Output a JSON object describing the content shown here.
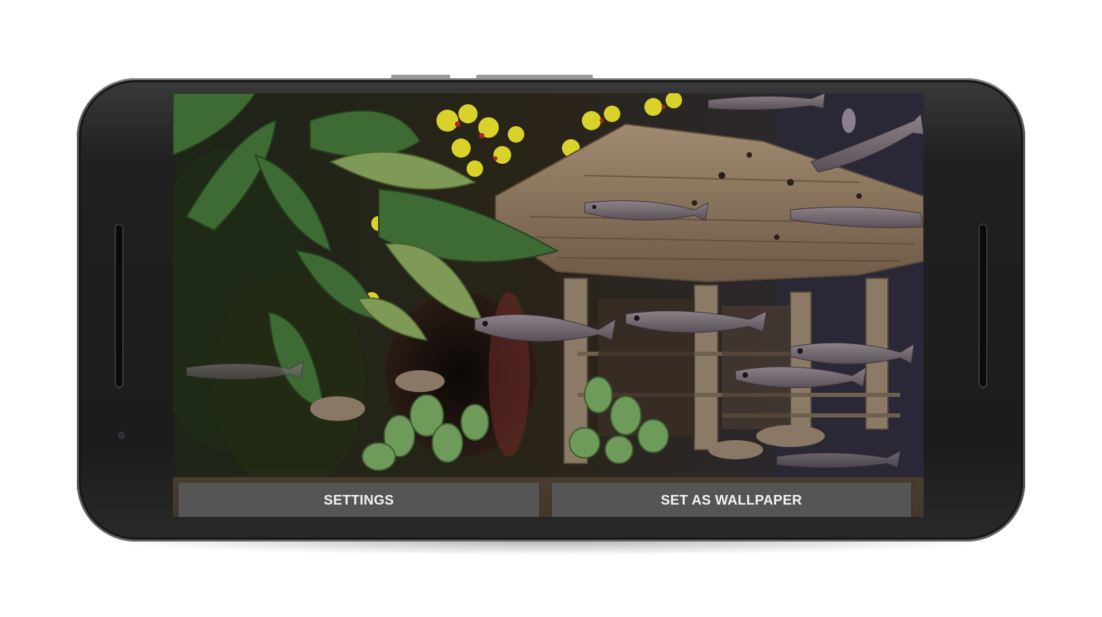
{
  "device": {
    "type": "smartphone-landscape",
    "frame_color": "#1f1f1f"
  },
  "wallpaper_preview": {
    "subject": "aquarium scene with plants, thatched hut and fish"
  },
  "actions": {
    "settings_label": "SETTINGS",
    "set_wallpaper_label": "SET AS WALLPAPER",
    "button_color": "#555555",
    "button_text_color": "#f2f2f2"
  }
}
